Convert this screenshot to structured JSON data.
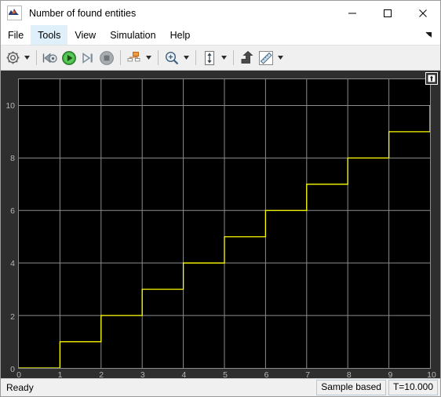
{
  "window": {
    "title": "Number of found entities",
    "app_icon": "matlab-membrane-icon",
    "minimize_label": "—",
    "maximize_label": "□",
    "close_label": "✕"
  },
  "menubar": {
    "items": [
      {
        "label": "File",
        "name": "menu-file",
        "active": false
      },
      {
        "label": "Tools",
        "name": "menu-tools",
        "active": true
      },
      {
        "label": "View",
        "name": "menu-view",
        "active": false
      },
      {
        "label": "Simulation",
        "name": "menu-simulation",
        "active": false
      },
      {
        "label": "Help",
        "name": "menu-help",
        "active": false
      }
    ],
    "overflow_icon": "menu-overflow-arrow-icon"
  },
  "toolbar": {
    "items": [
      {
        "name": "configuration-properties-button",
        "icon": "gear-icon",
        "dropdown": true
      },
      {
        "name": "separator-1",
        "icon": "separator",
        "dropdown": false
      },
      {
        "name": "run-back-to-start-button",
        "icon": "rewind-icon",
        "dropdown": false
      },
      {
        "name": "run-button",
        "icon": "play-icon",
        "dropdown": false
      },
      {
        "name": "step-forward-button",
        "icon": "step-forward-icon",
        "dropdown": false
      },
      {
        "name": "stop-button",
        "icon": "stop-icon",
        "dropdown": false
      },
      {
        "name": "separator-2",
        "icon": "separator",
        "dropdown": false
      },
      {
        "name": "signal-selection-button",
        "icon": "signal-hierarchy-icon",
        "dropdown": true
      },
      {
        "name": "separator-3",
        "icon": "separator",
        "dropdown": false
      },
      {
        "name": "zoom-in-button",
        "icon": "zoom-in-magnifier-icon",
        "dropdown": true
      },
      {
        "name": "separator-4",
        "icon": "separator",
        "dropdown": false
      },
      {
        "name": "autoscale-button",
        "icon": "autoscale-arrows-icon",
        "dropdown": true
      },
      {
        "name": "separator-5",
        "icon": "separator",
        "dropdown": false
      },
      {
        "name": "style-button",
        "icon": "style-arrow-icon",
        "dropdown": false
      },
      {
        "name": "measurements-button",
        "icon": "ruler-icon",
        "dropdown": true
      }
    ]
  },
  "scope": {
    "corner_button_name": "scope-maximize-axes-button",
    "corner_icon": "maximize-axes-icon",
    "plot_bg_color": "#000000",
    "grid_color": "#8d8d8d",
    "trace_color": "#ffff00",
    "panel_bg_color": "#2e2e2e",
    "tick_text_color": "#b5b5b5"
  },
  "statusbar": {
    "ready_text": "Ready",
    "frame_mode": "Sample based",
    "time": "T=10.000"
  },
  "chart_data": {
    "type": "line",
    "title": "Number of found entities",
    "xlabel": "",
    "ylabel": "",
    "xlim": [
      0,
      10
    ],
    "ylim": [
      0,
      11
    ],
    "grid": true,
    "legend": null,
    "xticks": [
      0,
      1,
      2,
      3,
      4,
      5,
      6,
      7,
      8,
      9,
      10
    ],
    "yticks": [
      0,
      2,
      4,
      6,
      8,
      10
    ],
    "series": [
      {
        "name": "Number of found entities",
        "color": "#ffff00",
        "style": "stairs",
        "x": [
          0,
          1,
          1,
          2,
          2,
          3,
          3,
          4,
          4,
          5,
          5,
          6,
          6,
          7,
          7,
          8,
          8,
          9,
          9,
          10,
          10
        ],
        "y": [
          0,
          0,
          1,
          1,
          2,
          2,
          3,
          3,
          4,
          4,
          5,
          5,
          6,
          6,
          7,
          7,
          8,
          8,
          9,
          9,
          10
        ]
      }
    ]
  }
}
